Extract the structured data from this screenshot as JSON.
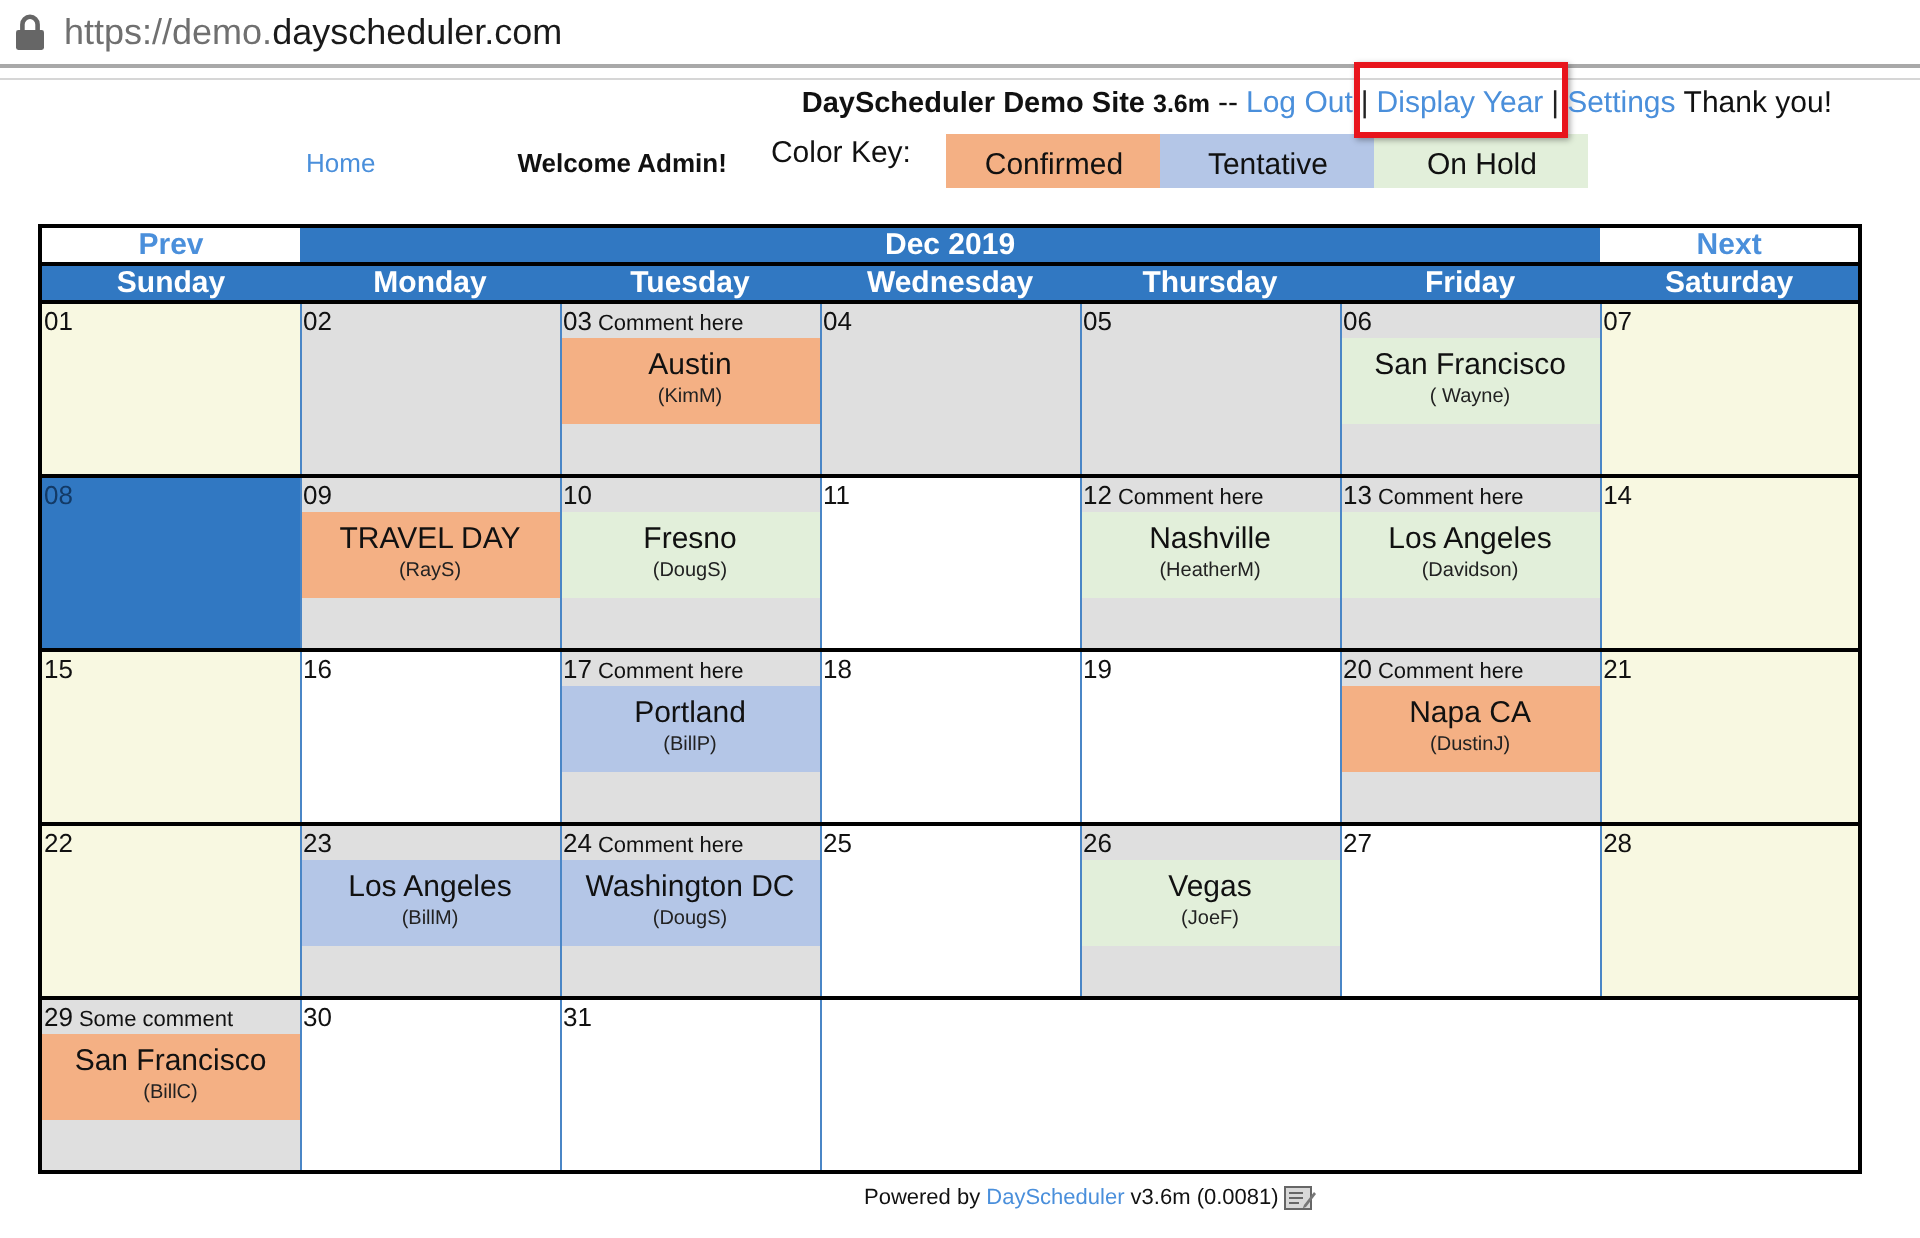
{
  "browser": {
    "url_prefix": "https://demo.",
    "url_domain": "dayscheduler.com"
  },
  "header": {
    "title": "DayScheduler Demo Site",
    "version": "3.6m",
    "dash": "--",
    "nav": [
      {
        "kind": "link",
        "text": "Log Out",
        "highlighted": false
      },
      {
        "kind": "separator",
        "text": "|",
        "highlighted": false
      },
      {
        "kind": "link",
        "text": "Display Year",
        "highlighted": true
      },
      {
        "kind": "separator",
        "text": "|",
        "highlighted": false
      },
      {
        "kind": "link",
        "text": "Settings",
        "highlighted": false
      }
    ],
    "thanks": "Thank you!"
  },
  "subheader": {
    "home": "Home",
    "welcome": "Welcome Admin!",
    "color_key_label": "Color Key:",
    "color_key": [
      {
        "label": "Confirmed",
        "color": "#f4b084"
      },
      {
        "label": "Tentative",
        "color": "#b4c6e7"
      },
      {
        "label": "On Hold",
        "color": "#e2efda"
      }
    ]
  },
  "calendar": {
    "prev": "Prev",
    "month": "Dec 2019",
    "next": "Next",
    "weekdays": [
      "Sunday",
      "Monday",
      "Tuesday",
      "Wednesday",
      "Thursday",
      "Friday",
      "Saturday"
    ],
    "weeks": [
      {
        "days": [
          {
            "day": "01",
            "kind": "weekend"
          },
          {
            "day": "02",
            "kind": "shaded"
          },
          {
            "day": "03",
            "kind": "shaded",
            "comment": "Comment here",
            "event": {
              "title": "Austin",
              "person": "(KimM)",
              "color": "#f4b084"
            }
          },
          {
            "day": "04",
            "kind": "shaded"
          },
          {
            "day": "05",
            "kind": "shaded"
          },
          {
            "day": "06",
            "kind": "shaded",
            "event": {
              "title": "San Francisco",
              "person": "( Wayne)",
              "color": "#e2efda"
            }
          },
          {
            "day": "07",
            "kind": "weekend"
          }
        ]
      },
      {
        "days": [
          {
            "day": "08",
            "kind": "current"
          },
          {
            "day": "09",
            "kind": "shaded",
            "event": {
              "title": "TRAVEL DAY",
              "person": "(RayS)",
              "color": "#f4b084"
            }
          },
          {
            "day": "10",
            "kind": "shaded",
            "event": {
              "title": "Fresno",
              "person": "(DougS)",
              "color": "#e2efda"
            }
          },
          {
            "day": "11",
            "kind": "plain"
          },
          {
            "day": "12",
            "kind": "shaded",
            "comment": "Comment here",
            "event": {
              "title": "Nashville",
              "person": "(HeatherM)",
              "color": "#e2efda"
            }
          },
          {
            "day": "13",
            "kind": "shaded",
            "comment": "Comment here",
            "event": {
              "title": "Los Angeles",
              "person": "(Davidson)",
              "color": "#e2efda"
            }
          },
          {
            "day": "14",
            "kind": "weekend"
          }
        ]
      },
      {
        "days": [
          {
            "day": "15",
            "kind": "weekend"
          },
          {
            "day": "16",
            "kind": "plain"
          },
          {
            "day": "17",
            "kind": "shaded",
            "comment": "Comment here",
            "event": {
              "title": "Portland",
              "person": "(BillP)",
              "color": "#b4c6e7"
            }
          },
          {
            "day": "18",
            "kind": "plain"
          },
          {
            "day": "19",
            "kind": "plain"
          },
          {
            "day": "20",
            "kind": "shaded",
            "comment": "Comment here",
            "event": {
              "title": "Napa CA",
              "person": "(DustinJ)",
              "color": "#f4b084"
            }
          },
          {
            "day": "21",
            "kind": "weekend"
          }
        ]
      },
      {
        "days": [
          {
            "day": "22",
            "kind": "weekend"
          },
          {
            "day": "23",
            "kind": "shaded",
            "event": {
              "title": "Los Angeles",
              "person": "(BillM)",
              "color": "#b4c6e7"
            }
          },
          {
            "day": "24",
            "kind": "shaded",
            "comment": "Comment here",
            "event": {
              "title": "Washington DC",
              "person": "(DougS)",
              "color": "#b4c6e7"
            }
          },
          {
            "day": "25",
            "kind": "plain"
          },
          {
            "day": "26",
            "kind": "shaded",
            "event": {
              "title": "Vegas",
              "person": "(JoeF)",
              "color": "#e2efda"
            }
          },
          {
            "day": "27",
            "kind": "plain"
          },
          {
            "day": "28",
            "kind": "weekend"
          }
        ]
      },
      {
        "days": [
          {
            "day": "29",
            "kind": "shaded",
            "comment": "Some comment",
            "event": {
              "title": "San Francisco",
              "person": "(BillC)",
              "color": "#f4b084"
            }
          },
          {
            "day": "30",
            "kind": "plain"
          },
          {
            "day": "31",
            "kind": "plain"
          }
        ]
      }
    ]
  },
  "footer": {
    "text_before": "Powered by",
    "link": "DayScheduler",
    "text_after": "v3.6m (0.0081)"
  }
}
